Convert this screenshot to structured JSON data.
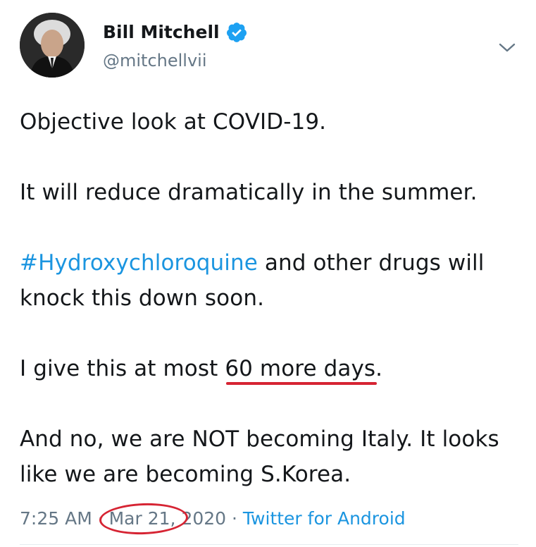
{
  "author": {
    "display_name": "Bill Mitchell",
    "handle": "@mitchellvii",
    "verified_icon": "verified-badge-icon",
    "avatar_icon": "avatar"
  },
  "menu": {
    "icon": "chevron-down-icon"
  },
  "tweet": {
    "line1": "Objective look at COVID-19.",
    "line2": "It will reduce dramatically in the summer.",
    "hashtag": "#Hydroxychloroquine",
    "line3_rest": " and other drugs will knock this down soon.",
    "line4_pre": "I give this at most ",
    "line4_highlight": "60 more days",
    "line4_post": ".",
    "line5": "And no, we are NOT becoming Italy. It looks like we are becoming S.Korea."
  },
  "meta": {
    "time": "7:25 AM",
    "sep1": " · ",
    "date": "Mar 21",
    "year": ", 2020",
    "sep2": " · ",
    "source": "Twitter for Android"
  },
  "colors": {
    "link": "#1b95e0",
    "annotation_red": "#d62433",
    "muted": "#657786",
    "text": "#14171a"
  }
}
